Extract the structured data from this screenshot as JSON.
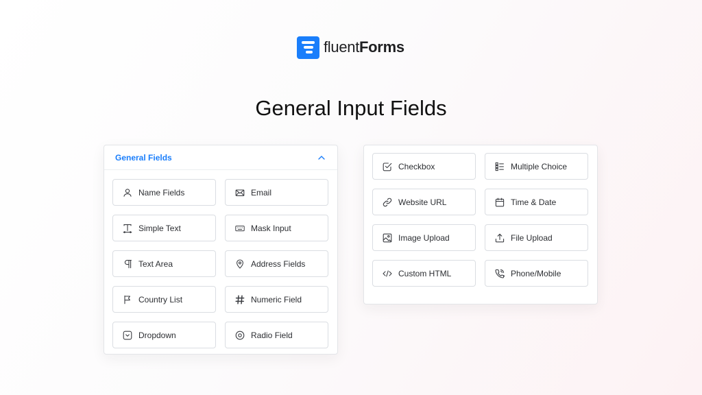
{
  "brand": {
    "name_light": "fluent",
    "name_bold": "Forms",
    "accent": "#1a7efb"
  },
  "title": "General Input Fields",
  "general_fields": {
    "header": "General Fields",
    "items": [
      {
        "label": "Name Fields",
        "icon": "user-icon"
      },
      {
        "label": "Email",
        "icon": "envelope-icon"
      },
      {
        "label": "Simple Text",
        "icon": "text-cursor-icon"
      },
      {
        "label": "Mask Input",
        "icon": "keyboard-icon"
      },
      {
        "label": "Text Area",
        "icon": "paragraph-icon"
      },
      {
        "label": "Address Fields",
        "icon": "map-pin-icon"
      },
      {
        "label": "Country List",
        "icon": "flag-icon"
      },
      {
        "label": "Numeric Field",
        "icon": "hash-icon"
      },
      {
        "label": "Dropdown",
        "icon": "dropdown-icon"
      },
      {
        "label": "Radio Field",
        "icon": "radio-icon"
      }
    ]
  },
  "more_fields": {
    "items": [
      {
        "label": "Checkbox",
        "icon": "checkbox-icon"
      },
      {
        "label": "Multiple Choice",
        "icon": "list-icon"
      },
      {
        "label": "Website URL",
        "icon": "link-icon"
      },
      {
        "label": "Time & Date",
        "icon": "calendar-icon"
      },
      {
        "label": "Image Upload",
        "icon": "image-icon"
      },
      {
        "label": "File Upload",
        "icon": "upload-icon"
      },
      {
        "label": "Custom HTML",
        "icon": "code-icon"
      },
      {
        "label": "Phone/Mobile",
        "icon": "phone-icon"
      }
    ]
  }
}
